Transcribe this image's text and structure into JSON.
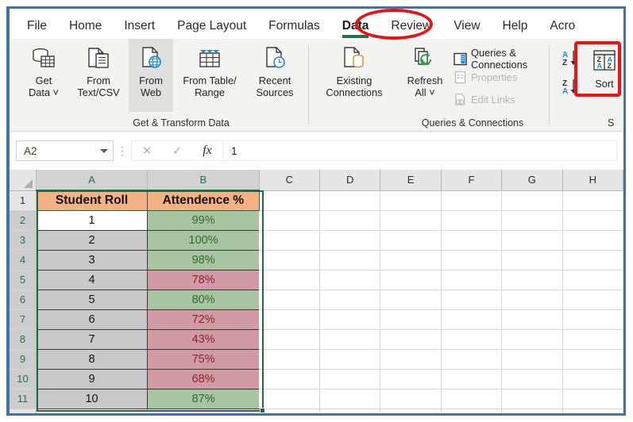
{
  "app": {
    "name": "Microsoft Excel",
    "accent_blue": "#4472a8",
    "excel_green": "#217346",
    "annotation_color": "#ee1111"
  },
  "ribbon_tabs": [
    {
      "label": "File",
      "active": false
    },
    {
      "label": "Home",
      "active": false
    },
    {
      "label": "Insert",
      "active": false
    },
    {
      "label": "Page Layout",
      "active": false
    },
    {
      "label": "Formulas",
      "active": false
    },
    {
      "label": "Data",
      "active": true
    },
    {
      "label": "Review",
      "active": false
    },
    {
      "label": "View",
      "active": false
    },
    {
      "label": "Help",
      "active": false
    },
    {
      "label": "Acro",
      "active": false
    }
  ],
  "ribbon": {
    "groups": [
      {
        "name": "get-transform-data",
        "label": "Get & Transform Data"
      },
      {
        "name": "queries-connections",
        "label": "Queries & Connections"
      },
      {
        "name": "sort-filter",
        "label": "S"
      }
    ],
    "get_transform": {
      "get_data": {
        "label": "Get\nData ˅",
        "icon": "database-table-icon"
      },
      "from_text_csv": {
        "label": "From\nText/CSV",
        "icon": "document-text-icon"
      },
      "from_web": {
        "label": "From\nWeb",
        "icon": "document-globe-icon",
        "selected": true
      },
      "from_table": {
        "label": "From Table/\nRange",
        "icon": "table-icon"
      },
      "recent_sources": {
        "label": "Recent\nSources",
        "icon": "document-clock-icon"
      },
      "existing_conn": {
        "label": "Existing\nConnections",
        "icon": "document-database-icon"
      }
    },
    "queries": {
      "refresh_all": {
        "label": "Refresh\nAll ˅",
        "icon": "refresh-icon"
      },
      "queries_conn": {
        "label": "Queries & Connections",
        "icon": "queries-panel-icon",
        "disabled": false
      },
      "properties": {
        "label": "Properties",
        "icon": "properties-icon",
        "disabled": true
      },
      "edit_links": {
        "label": "Edit Links",
        "icon": "edit-links-icon",
        "disabled": true
      }
    },
    "sort_filter": {
      "sort_az": {
        "label": "A→Z",
        "icon": "sort-ascending-icon"
      },
      "sort_za": {
        "label": "Z→A",
        "icon": "sort-descending-icon"
      },
      "sort": {
        "label": "Sort",
        "icon": "sort-dialog-icon"
      }
    }
  },
  "formula_bar": {
    "name_box_value": "A2",
    "cancel_icon": "close-icon",
    "confirm_icon": "check-icon",
    "function_icon": "fx-icon",
    "formula_value": "1"
  },
  "grid": {
    "column_headers": [
      "A",
      "B",
      "C",
      "D",
      "E",
      "F",
      "G",
      "H"
    ],
    "selected_columns": [
      "A",
      "B"
    ],
    "row_headers": [
      "1",
      "2",
      "3",
      "4",
      "5",
      "6",
      "7",
      "8",
      "9",
      "10",
      "11"
    ],
    "selected_rows": [
      "2",
      "3",
      "4",
      "5",
      "6",
      "7",
      "8",
      "9",
      "10",
      "11"
    ],
    "active_cell": "A2",
    "header_row": {
      "a": "Student Roll",
      "b": "Attendence %",
      "fill": "#f4b183"
    },
    "fills": {
      "good": "#a9c4a0",
      "bad": "#d09ba5",
      "roll": "#c9c9c9"
    },
    "rows": [
      {
        "roll": "1",
        "attendance": "99%",
        "status": "good"
      },
      {
        "roll": "2",
        "attendance": "100%",
        "status": "good"
      },
      {
        "roll": "3",
        "attendance": "98%",
        "status": "good"
      },
      {
        "roll": "4",
        "attendance": "78%",
        "status": "bad"
      },
      {
        "roll": "5",
        "attendance": "80%",
        "status": "good"
      },
      {
        "roll": "6",
        "attendance": "72%",
        "status": "bad"
      },
      {
        "roll": "7",
        "attendance": "43%",
        "status": "bad"
      },
      {
        "roll": "8",
        "attendance": "75%",
        "status": "bad"
      },
      {
        "roll": "9",
        "attendance": "68%",
        "status": "bad"
      },
      {
        "roll": "10",
        "attendance": "87%",
        "status": "good"
      }
    ]
  },
  "annotations": [
    {
      "name": "data-tab-highlight",
      "shape": "ellipse"
    },
    {
      "name": "sort-button-highlight",
      "shape": "rect"
    }
  ]
}
